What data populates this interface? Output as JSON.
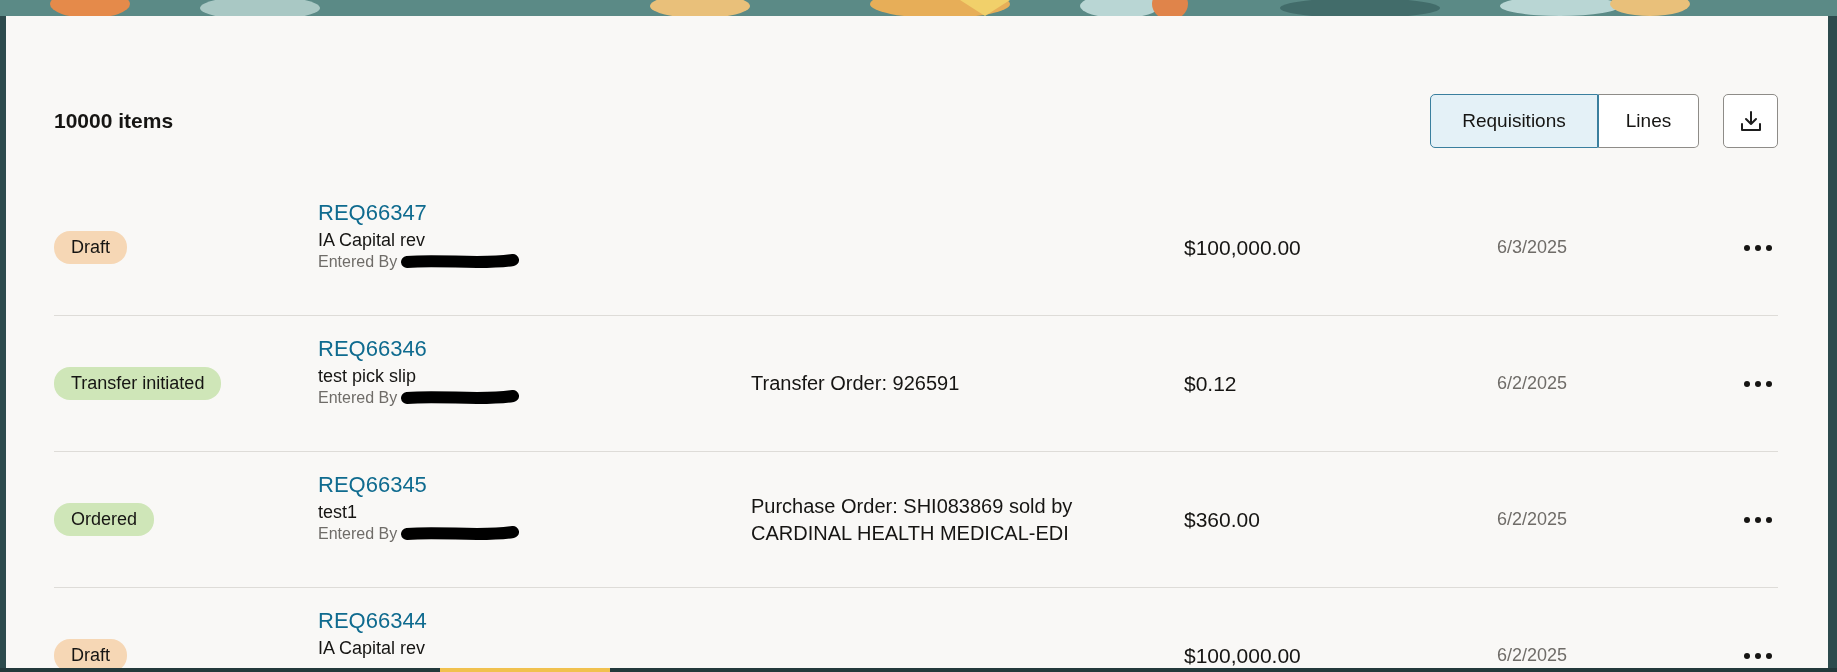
{
  "header": {
    "count": "10000 items",
    "view_toggle": [
      {
        "label": "Requisitions",
        "selected": true
      },
      {
        "label": "Lines",
        "selected": false
      }
    ]
  },
  "rows": [
    {
      "status": {
        "label": "Draft",
        "color": "#f6d7b5"
      },
      "number": "REQ66347",
      "description": "IA Capital rev",
      "entered_by": "Entered By",
      "amount": "$100,000.00",
      "date": "6/3/2025"
    },
    {
      "status": {
        "label": "Transfer initiated",
        "color": "#cfe6b8"
      },
      "number": "REQ66346",
      "description": "test pick slip",
      "entered_by": "Entered By",
      "order": "Transfer Order: 926591",
      "amount": "$0.12",
      "date": "6/2/2025"
    },
    {
      "status": {
        "label": "Ordered",
        "color": "#cfe6b8"
      },
      "number": "REQ66345",
      "description": "test1",
      "entered_by": "Entered By",
      "order": "Purchase Order: SHI083869 sold by CARDINAL HEALTH MEDICAL-EDI",
      "amount": "$360.00",
      "date": "6/2/2025"
    },
    {
      "status": {
        "label": "Draft",
        "color": "#f6d7b5"
      },
      "number": "REQ66344",
      "description": "IA Capital rev",
      "amount": "$100,000.00",
      "date": "6/2/2025"
    }
  ]
}
